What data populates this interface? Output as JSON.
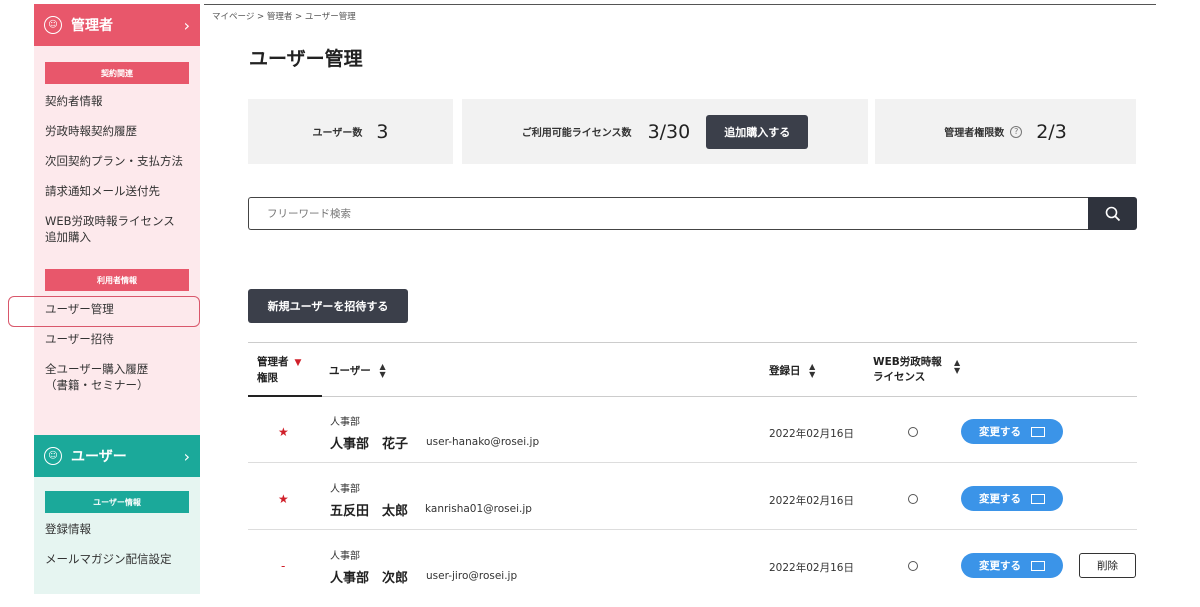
{
  "breadcrumb": "マイページ > 管理者 > ユーザー管理",
  "page_title": "ユーザー管理",
  "sidebar": {
    "admin_title": "管理者",
    "contract_section": "契約関連",
    "contract_items": [
      "契約者情報",
      "労政時報契約履歴",
      "次回契約プラン・支払方法",
      "請求通知メール送付先",
      "WEB労政時報ライセンス",
      "追加購入"
    ],
    "user_info_section": "利用者情報",
    "user_info_items": [
      "ユーザー管理",
      "ユーザー招待",
      "全ユーザー購入履歴",
      "（書籍・セミナー）"
    ],
    "user_title": "ユーザー",
    "user_section": "ユーザー情報",
    "user_items": [
      "登録情報",
      "メールマガジン配信設定"
    ],
    "colors": {
      "admin": "#e8576b",
      "user": "#1ba99a"
    }
  },
  "stats": {
    "user_count_label": "ユーザー数",
    "user_count_value": "3",
    "license_label": "ご利用可能ライセンス数",
    "license_value": "3/30",
    "add_purchase_label": "追加購入する",
    "admin_count_label": "管理者権限数",
    "admin_count_value": "2/3"
  },
  "search": {
    "placeholder": "フリーワード検索",
    "icon": "search-icon"
  },
  "invite_button": "新規ユーザーを招待する",
  "table": {
    "headers": {
      "admin_line1": "管理者",
      "admin_line2": "権限",
      "user": "ユーザー",
      "registered": "登録日",
      "license_line1": "WEB労政時報",
      "license_line2": "ライセンス"
    },
    "rows": [
      {
        "admin": "★",
        "dept": "人事部",
        "name": "人事部　花子",
        "email": "user-hanako@rosei.jp",
        "date": "2022年02月16日",
        "license": "○",
        "change": "変更する"
      },
      {
        "admin": "★",
        "dept": "人事部",
        "name": "五反田　太郎",
        "email": "kanrisha01@rosei.jp",
        "date": "2022年02月16日",
        "license": "○",
        "change": "変更する"
      },
      {
        "admin": "-",
        "dept": "人事部",
        "name": "人事部　次郎",
        "email": "user-jiro@rosei.jp",
        "date": "2022年02月16日",
        "license": "○",
        "change": "変更する",
        "delete": "削除"
      }
    ]
  }
}
